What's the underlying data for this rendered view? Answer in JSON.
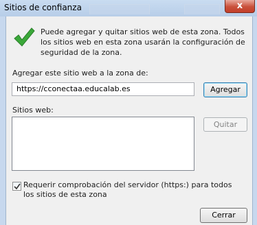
{
  "window": {
    "title": "Sitios de confianza",
    "close_glyph": "x"
  },
  "info": {
    "icon": "check-icon",
    "text": "Puede agregar y quitar sitios web de esta zona. Todos los sitios web en esta zona usarán la configuración de seguridad de la zona."
  },
  "add_site": {
    "label": "Agregar este sitio web a la zona de:",
    "value": "https://cconectaa.educalab.es",
    "button_label": "Agregar"
  },
  "sites": {
    "label": "Sitios web:",
    "items": [],
    "remove_button_label": "Quitar"
  },
  "require_https": {
    "checked": true,
    "label": "Requerir comprobación del servidor (https:) para todos los sitios de esta zona"
  },
  "footer": {
    "close_button_label": "Cerrar"
  },
  "colors": {
    "check_green": "#3aa839",
    "close_red": "#c9503a"
  }
}
